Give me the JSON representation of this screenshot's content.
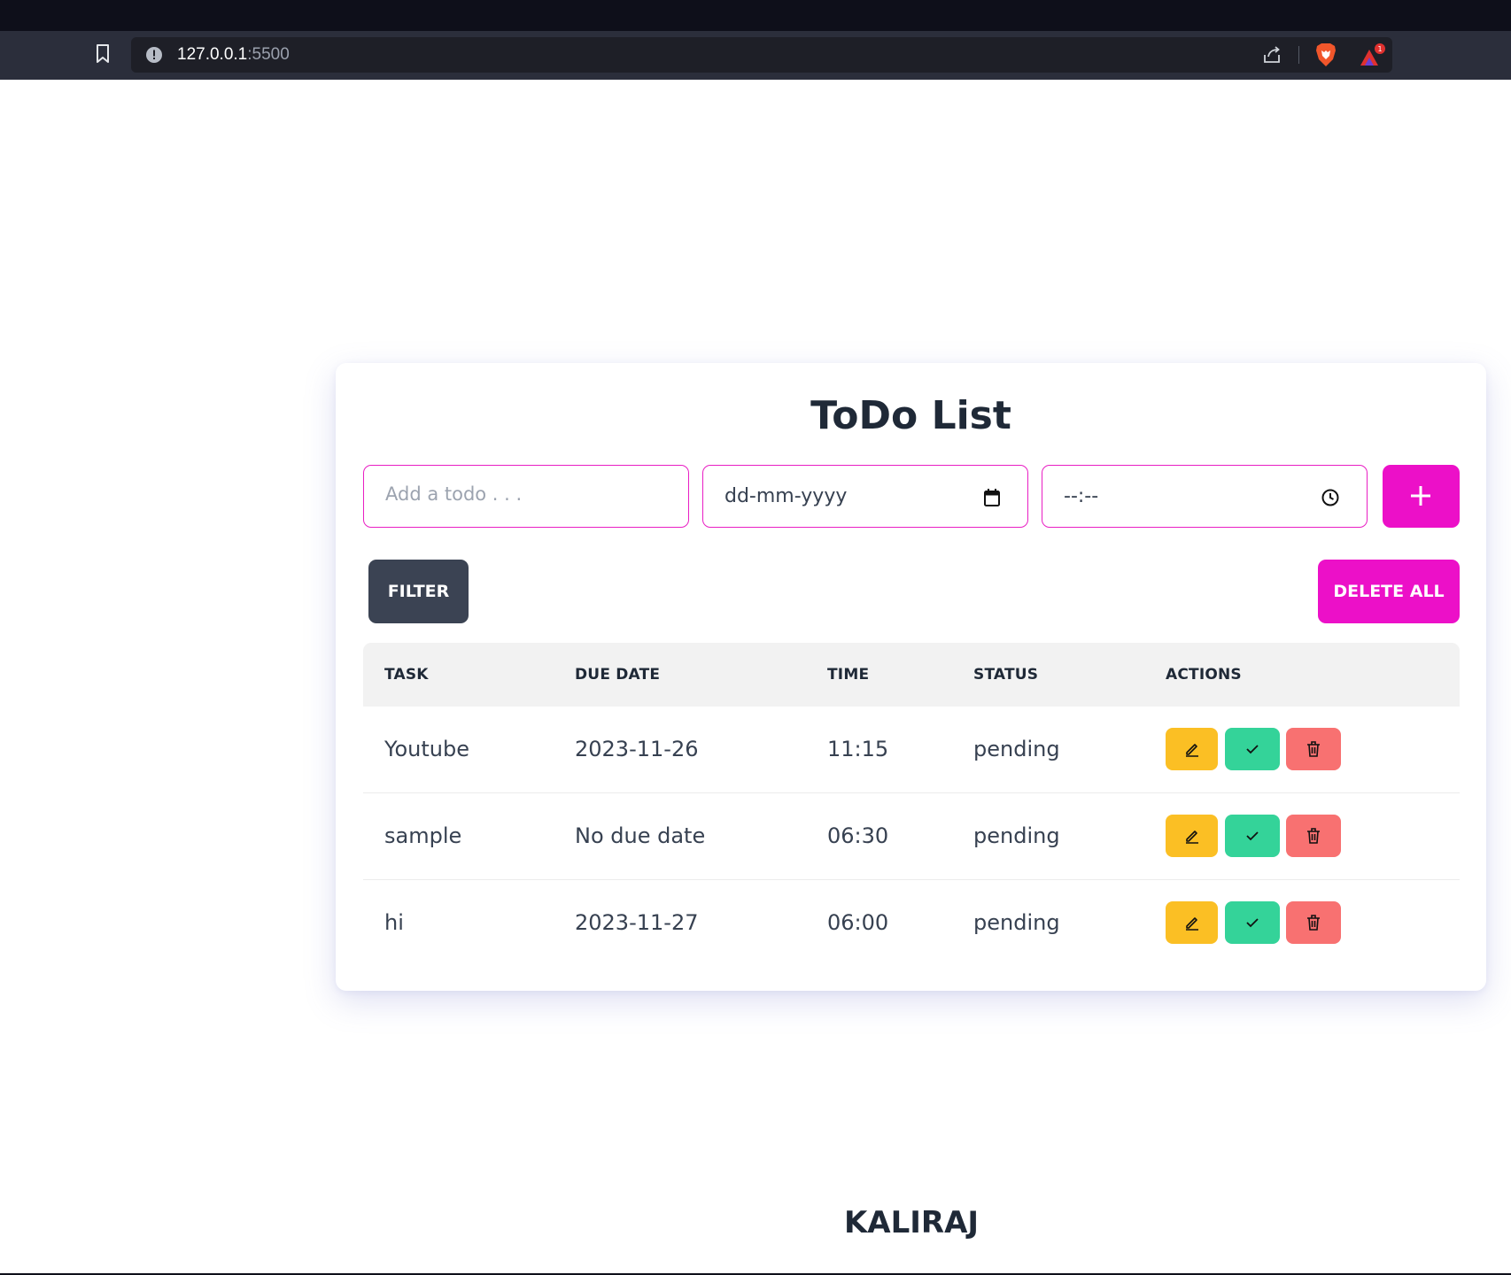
{
  "browser": {
    "url_host": "127.0.0.1",
    "url_port": ":5500",
    "rewards_badge": "1"
  },
  "app": {
    "title": "ToDo List",
    "todo_placeholder": "Add a todo . . .",
    "date_placeholder": "dd-mm-yyyy",
    "time_placeholder": "--:--",
    "add_label": "+",
    "filter_label": "FILTER",
    "delete_all_label": "DELETE ALL"
  },
  "table": {
    "headers": {
      "task": "TASK",
      "due_date": "DUE DATE",
      "time": "TIME",
      "status": "STATUS",
      "actions": "ACTIONS"
    },
    "rows": [
      {
        "task": "Youtube",
        "due_date": "2023-11-26",
        "time": "11:15",
        "status": "pending"
      },
      {
        "task": "sample",
        "due_date": "No due date",
        "time": "06:30",
        "status": "pending"
      },
      {
        "task": "hi",
        "due_date": "2023-11-27",
        "time": "06:00",
        "status": "pending"
      }
    ]
  },
  "footer": {
    "name": "KALIRAJ"
  },
  "colors": {
    "accent": "#ec10c8",
    "filter_bg": "#3b4353",
    "edit": "#fbbf24",
    "done": "#34d399",
    "delete": "#f87171"
  }
}
